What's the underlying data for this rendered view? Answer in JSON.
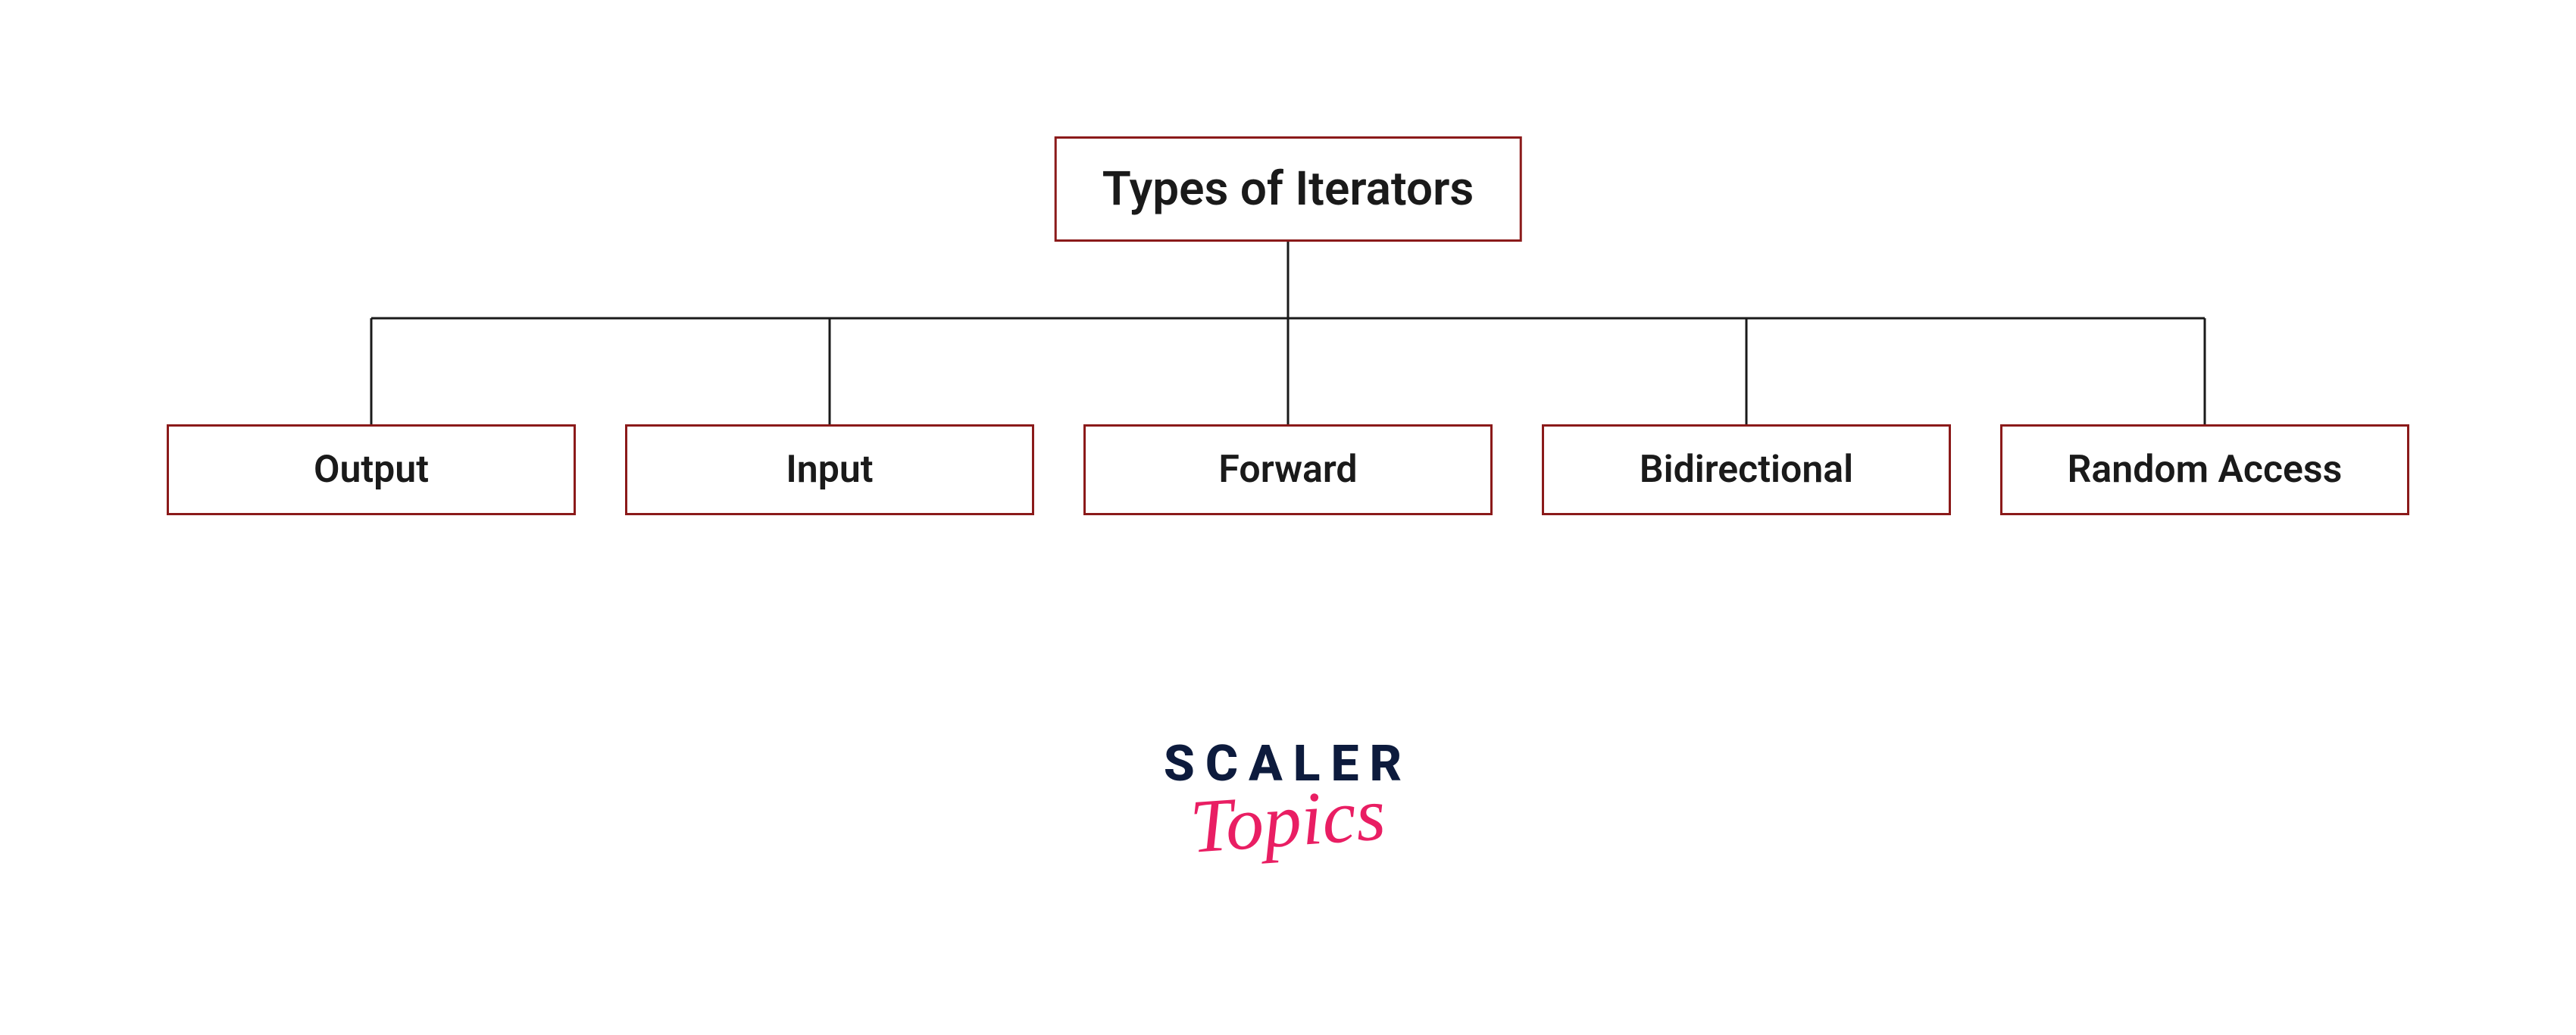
{
  "diagram": {
    "root": "Types of Iterators",
    "children": [
      "Output",
      "Input",
      "Forward",
      "Bidirectional",
      "Random Access"
    ]
  },
  "logo": {
    "line1": "SCALER",
    "line2": "Topics"
  },
  "colors": {
    "box_border": "#8b1a1a",
    "text": "#1a1a1a",
    "logo_dark": "#0d1b3d",
    "logo_pink": "#e91e63"
  }
}
